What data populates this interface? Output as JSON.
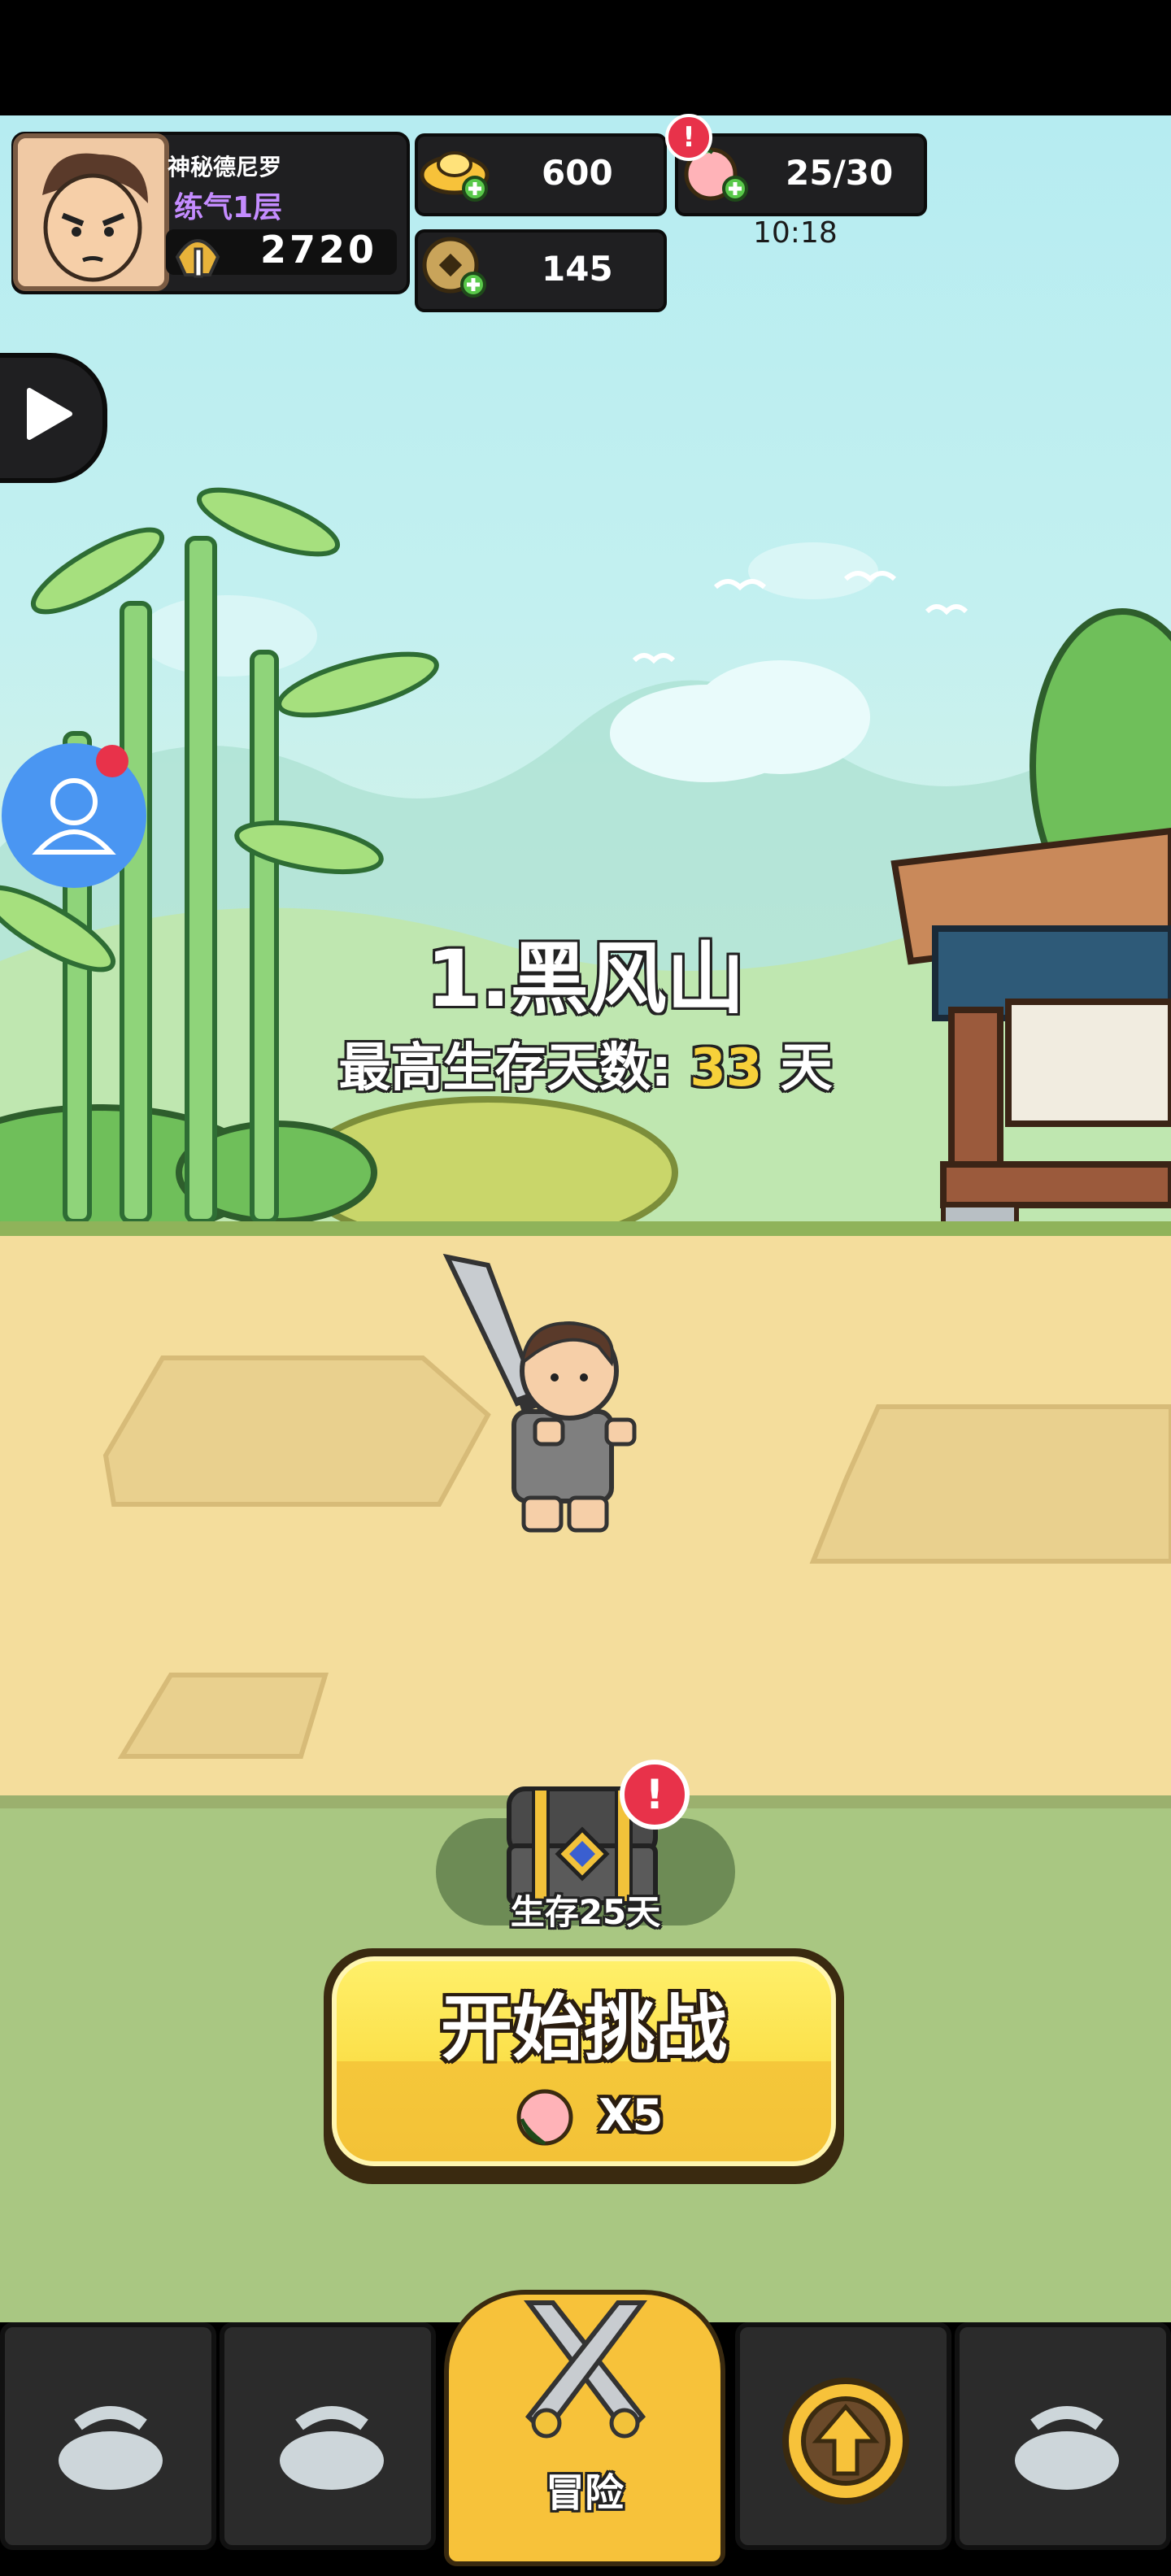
{
  "player": {
    "name": "神秘德尼罗",
    "realm": "练气1层",
    "power": "2720"
  },
  "resources": {
    "gold": "600",
    "coins": "145",
    "stamina": "25/30",
    "stamina_timer": "10:18"
  },
  "stage": {
    "title": "1.黑风山",
    "best_label": "最高生存天数:",
    "best_days": "33",
    "days_unit": "天"
  },
  "reward": {
    "label": "生存25天"
  },
  "start_button": {
    "label": "开始挑战",
    "cost": "X5"
  },
  "nav": {
    "adventure_label": "冒险"
  },
  "colors": {
    "highlight_yellow": "#f7d13a",
    "realm_purple": "#c48cff",
    "alert_red": "#e8324a"
  }
}
